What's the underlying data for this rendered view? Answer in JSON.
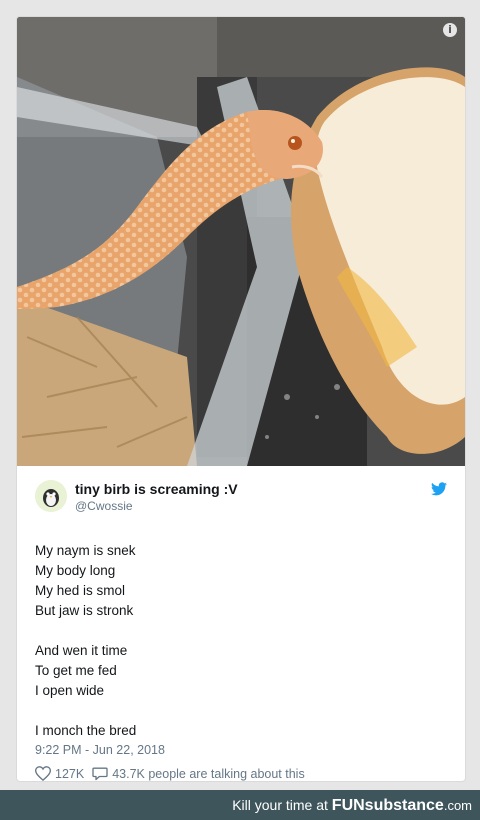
{
  "tweet": {
    "display_name": "tiny birb is screaming :V",
    "handle": "@Cwossie",
    "lines": [
      "My naym is snek",
      "My body long",
      "My hed is smol",
      "But jaw is stronk",
      "",
      "And wen it time",
      "To get me fed",
      "I open wide",
      "",
      "I monch the bred"
    ],
    "timestamp": "9:22 PM - Jun 22, 2018",
    "likes": "127K",
    "talking": "43.7K people are talking about this"
  },
  "photo": {
    "info_glyph": "i"
  },
  "footer": {
    "prefix": "Kill your time at",
    "brand": "FUNsubstance",
    "domain": ".com"
  },
  "colors": {
    "twitter_blue": "#1da1f2",
    "footer_bg": "#3f555c",
    "text_primary": "#14171a",
    "text_secondary": "#657786"
  },
  "icons": [
    "info-icon",
    "avatar-bird-icon",
    "twitter-bird-icon",
    "heart-icon",
    "comment-icon"
  ]
}
